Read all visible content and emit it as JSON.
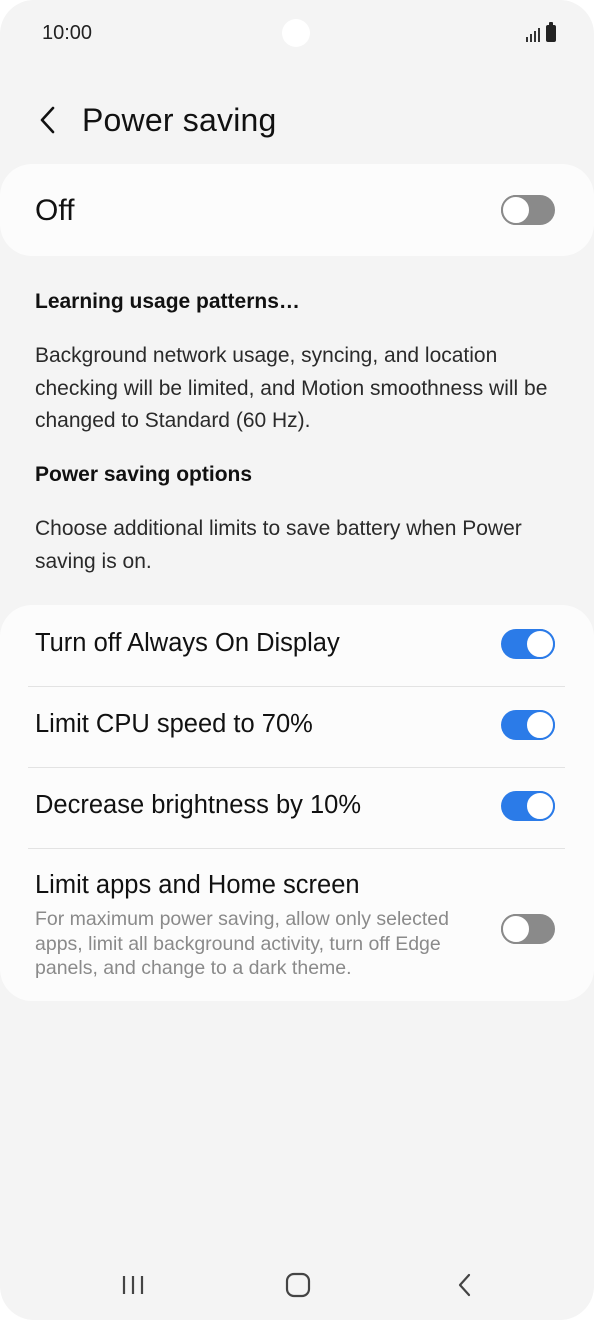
{
  "status_bar": {
    "time": "10:00",
    "signal_icon": "signal-icon",
    "battery_icon": "battery-icon"
  },
  "header": {
    "back_icon": "chevron-left-icon",
    "title": "Power saving"
  },
  "master_switch": {
    "label": "Off",
    "state": "off"
  },
  "info": {
    "heading": "Learning usage patterns…",
    "description": "Background network usage, syncing, and location checking will be limited, and Motion smoothness will be changed to Standard (60 Hz).",
    "options_heading": "Power saving options",
    "options_description": "Choose additional limits to save battery when Power saving is on."
  },
  "options": [
    {
      "label": "Turn off Always On Display",
      "subtitle": "",
      "state": "on"
    },
    {
      "label": "Limit CPU speed to 70%",
      "subtitle": "",
      "state": "on"
    },
    {
      "label": "Decrease brightness by 10%",
      "subtitle": "",
      "state": "on"
    },
    {
      "label": "Limit apps and Home screen",
      "subtitle": "For maximum power saving, allow only selected apps, limit all background activity, turn off Edge panels, and change to a dark theme.",
      "state": "off"
    }
  ],
  "nav_bar": {
    "recents_icon": "recents-icon",
    "home_icon": "home-icon",
    "back_icon": "back-icon"
  },
  "colors": {
    "accent": "#2b7be8",
    "toggle_off": "#8a8a8a",
    "background": "#f4f4f4",
    "card": "#fcfcfc"
  }
}
